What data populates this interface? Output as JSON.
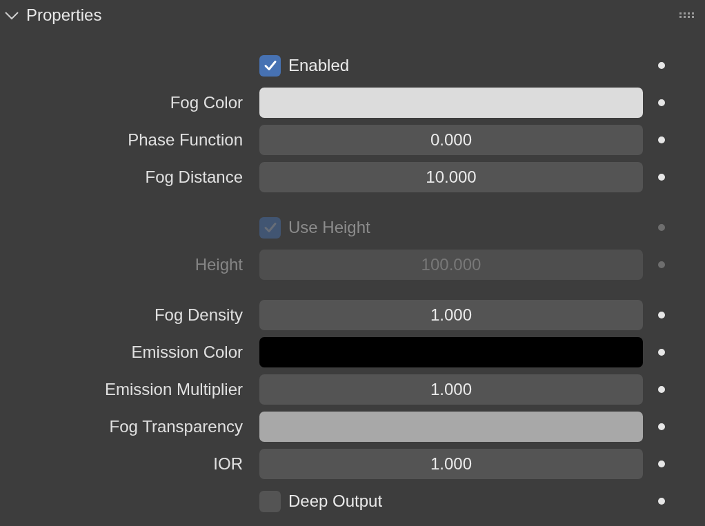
{
  "panel": {
    "title": "Properties",
    "expanded": true
  },
  "groups": [
    {
      "rows": [
        {
          "kind": "checkbox",
          "label": "Enabled",
          "checked": true,
          "disabled": false
        },
        {
          "kind": "color",
          "label": "Fog Color",
          "color": "#dcdcdc",
          "disabled": false
        },
        {
          "kind": "number",
          "label": "Phase Function",
          "value": "0.000",
          "disabled": false
        },
        {
          "kind": "number",
          "label": "Fog Distance",
          "value": "10.000",
          "disabled": false
        }
      ]
    },
    {
      "rows": [
        {
          "kind": "checkbox",
          "label": "Use Height",
          "checked": true,
          "disabled": true
        },
        {
          "kind": "number",
          "label": "Height",
          "value": "100.000",
          "disabled": true
        }
      ]
    },
    {
      "rows": [
        {
          "kind": "number",
          "label": "Fog Density",
          "value": "1.000",
          "disabled": false
        },
        {
          "kind": "color",
          "label": "Emission Color",
          "color": "#000000",
          "disabled": false
        },
        {
          "kind": "number",
          "label": "Emission Multiplier",
          "value": "1.000",
          "disabled": false
        },
        {
          "kind": "color",
          "label": "Fog Transparency",
          "color": "#a8a8a8",
          "disabled": false
        },
        {
          "kind": "number",
          "label": "IOR",
          "value": "1.000",
          "disabled": false
        },
        {
          "kind": "checkbox",
          "label": "Deep Output",
          "checked": false,
          "disabled": false
        }
      ]
    }
  ]
}
